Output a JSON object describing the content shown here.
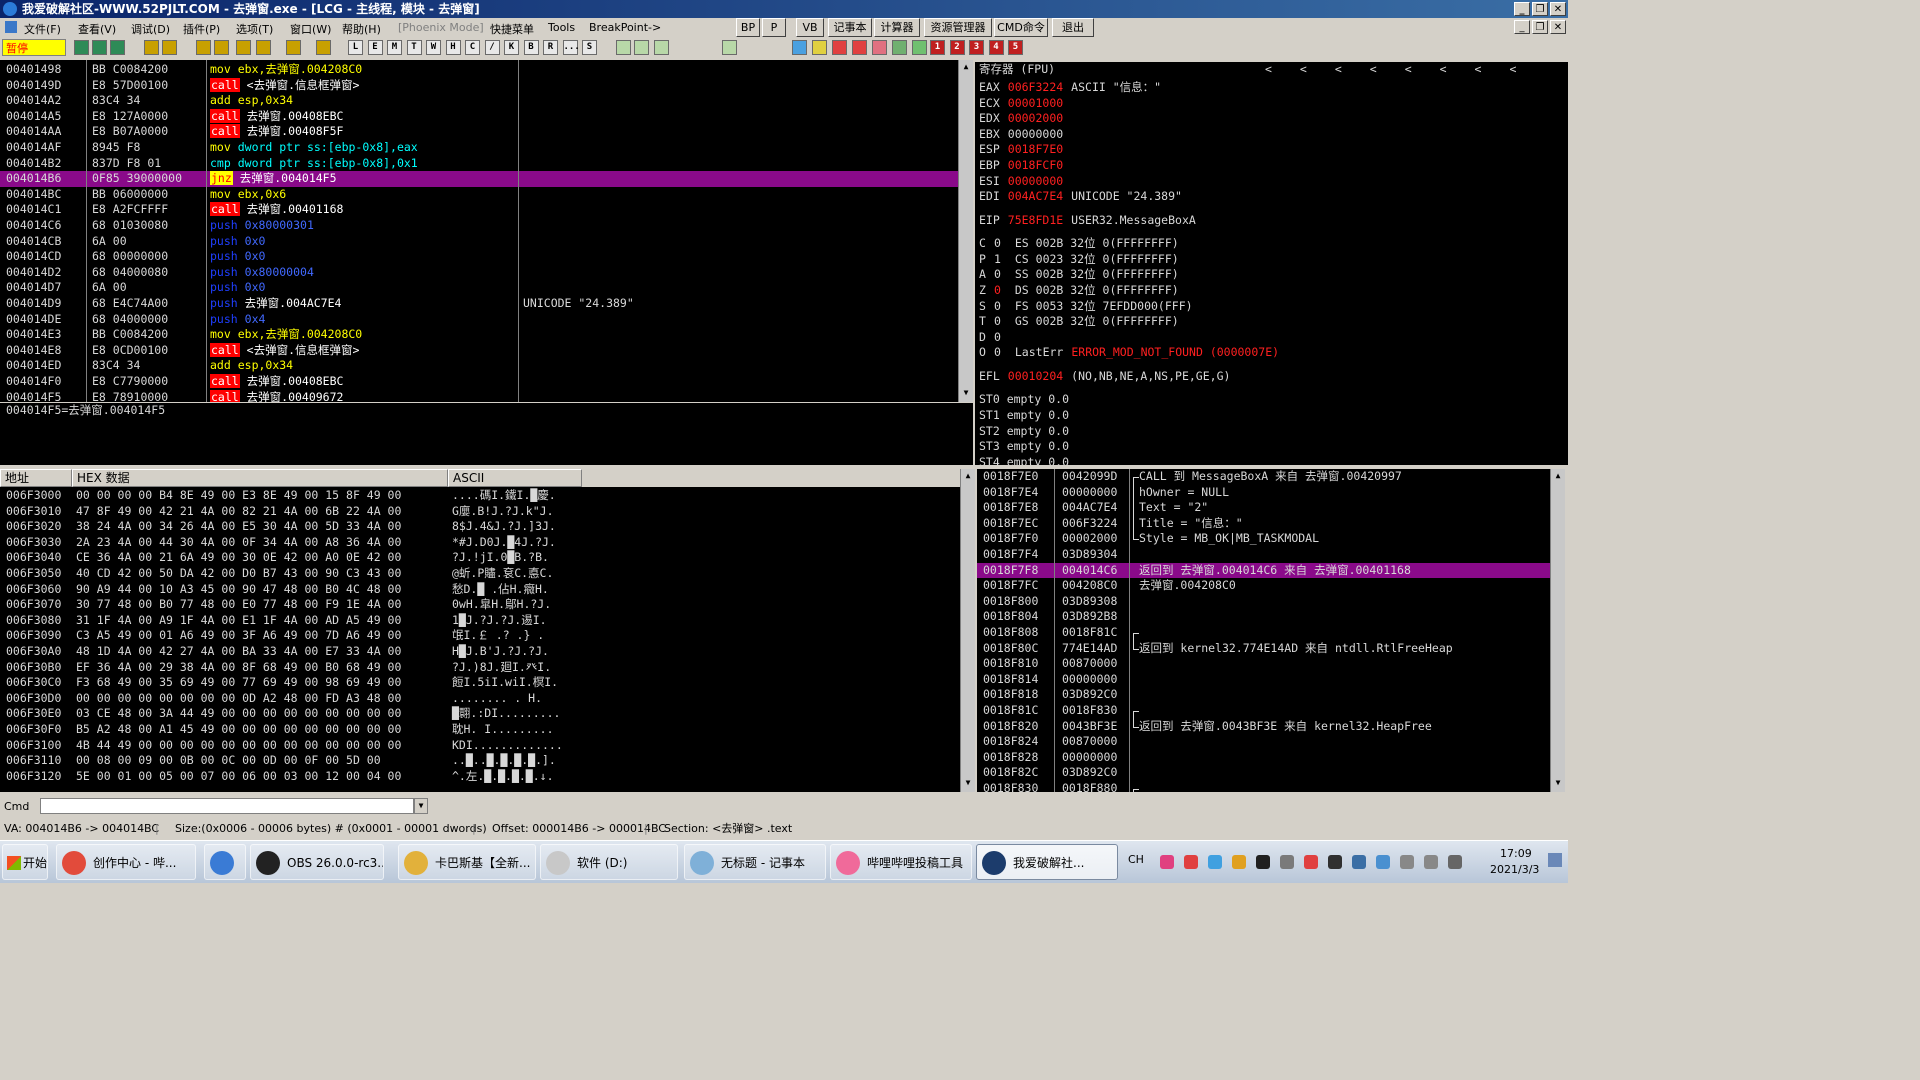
{
  "title": "我爱破解社区-WWW.52PJLT.COM - 去弹窗.exe - [LCG - 主线程, 模块 - 去弹窗]",
  "menu": {
    "items": [
      "文件(F)",
      "查看(V)",
      "调试(D)",
      "插件(P)",
      "选项(T)",
      "窗口(W)",
      "帮助(H)",
      "[Phoenix Mode]",
      "快捷菜单",
      "Tools",
      "BreakPoint->"
    ],
    "buttons": [
      "BP",
      "P",
      "VB",
      "记事本",
      "计算器",
      "资源管理器",
      "CMD命令",
      "退出"
    ]
  },
  "toolbar": {
    "status": "暂停",
    "letters": [
      "L",
      "E",
      "M",
      "T",
      "W",
      "H",
      "C",
      "/",
      "K",
      "B",
      "R",
      "...",
      "S"
    ],
    "numbers": [
      "1",
      "2",
      "3",
      "4",
      "5"
    ]
  },
  "disasm": {
    "rows": [
      {
        "addr": "00401498",
        "hex": "BB C0084200",
        "mn": "mov",
        "mncls": "kw-mov",
        "ops": "ebx,去弹窗.004208C0",
        "opcls": "opnd-y",
        "cmt": ""
      },
      {
        "addr": "0040149D",
        "hex": "E8 57D00100",
        "mn": "call",
        "mncls": "kw-call",
        "ops": "<去弹窗.信息框弹窗>",
        "opcls": "opnd-w",
        "cmt": ""
      },
      {
        "addr": "004014A2",
        "hex": "83C4 34",
        "mn": "add",
        "mncls": "kw-add",
        "ops": "esp,0x34",
        "opcls": "opnd-y",
        "cmt": ""
      },
      {
        "addr": "004014A5",
        "hex": "E8 127A0000",
        "mn": "call",
        "mncls": "kw-call",
        "ops": "去弹窗.00408EBC",
        "opcls": "opnd-w",
        "cmt": ""
      },
      {
        "addr": "004014AA",
        "hex": "E8 B07A0000",
        "mn": "call",
        "mncls": "kw-call",
        "ops": "去弹窗.00408F5F",
        "opcls": "opnd-w",
        "cmt": ""
      },
      {
        "addr": "004014AF",
        "hex": "8945 F8",
        "mn": "mov",
        "mncls": "kw-mov",
        "ops": "dword ptr ss:[ebp-0x8],eax",
        "opcls": "opnd-c",
        "cmt": ""
      },
      {
        "addr": "004014B2",
        "hex": "837D F8 01",
        "mn": "cmp",
        "mncls": "kw-cmp",
        "ops": "dword ptr ss:[ebp-0x8],0x1",
        "opcls": "opnd-c",
        "cmt": ""
      },
      {
        "addr": "004014B6",
        "hex": "0F85 39000000",
        "mn": "jnz",
        "mncls": "kw-jnz",
        "ops": "去弹窗.004014F5",
        "opcls": "opnd-w",
        "cmt": "",
        "sel": true
      },
      {
        "addr": "004014BC",
        "hex": "BB 06000000",
        "mn": "mov",
        "mncls": "kw-mov",
        "ops": "ebx,0x6",
        "opcls": "opnd-y",
        "cmt": ""
      },
      {
        "addr": "004014C1",
        "hex": "E8 A2FCFFFF",
        "mn": "call",
        "mncls": "kw-call",
        "ops": "去弹窗.00401168",
        "opcls": "opnd-w",
        "cmt": ""
      },
      {
        "addr": "004014C6",
        "hex": "68 01030080",
        "mn": "push",
        "mncls": "kw-push",
        "ops": "0x80000301",
        "opcls": "opnd-b",
        "cmt": ""
      },
      {
        "addr": "004014CB",
        "hex": "6A 00",
        "mn": "push",
        "mncls": "kw-push",
        "ops": "0x0",
        "opcls": "opnd-b",
        "cmt": ""
      },
      {
        "addr": "004014CD",
        "hex": "68 00000000",
        "mn": "push",
        "mncls": "kw-push",
        "ops": "0x0",
        "opcls": "opnd-b",
        "cmt": ""
      },
      {
        "addr": "004014D2",
        "hex": "68 04000080",
        "mn": "push",
        "mncls": "kw-push",
        "ops": "0x80000004",
        "opcls": "opnd-b",
        "cmt": ""
      },
      {
        "addr": "004014D7",
        "hex": "6A 00",
        "mn": "push",
        "mncls": "kw-push",
        "ops": "0x0",
        "opcls": "opnd-b",
        "cmt": ""
      },
      {
        "addr": "004014D9",
        "hex": "68 E4C74A00",
        "mn": "push",
        "mncls": "kw-push",
        "ops": "去弹窗.004AC7E4",
        "opcls": "opnd-w",
        "cmt": "UNICODE \"24.389\""
      },
      {
        "addr": "004014DE",
        "hex": "68 04000000",
        "mn": "push",
        "mncls": "kw-push",
        "ops": "0x4",
        "opcls": "opnd-b",
        "cmt": ""
      },
      {
        "addr": "004014E3",
        "hex": "BB C0084200",
        "mn": "mov",
        "mncls": "kw-mov",
        "ops": "ebx,去弹窗.004208C0",
        "opcls": "opnd-y",
        "cmt": ""
      },
      {
        "addr": "004014E8",
        "hex": "E8 0CD00100",
        "mn": "call",
        "mncls": "kw-call",
        "ops": "<去弹窗.信息框弹窗>",
        "opcls": "opnd-w",
        "cmt": ""
      },
      {
        "addr": "004014ED",
        "hex": "83C4 34",
        "mn": "add",
        "mncls": "kw-add",
        "ops": "esp,0x34",
        "opcls": "opnd-y",
        "cmt": ""
      },
      {
        "addr": "004014F0",
        "hex": "E8 C7790000",
        "mn": "call",
        "mncls": "kw-call",
        "ops": "去弹窗.00408EBC",
        "opcls": "opnd-w",
        "cmt": ""
      },
      {
        "addr": "004014F5",
        "hex": "E8 78910000",
        "mn": "call",
        "mncls": "kw-call",
        "ops": "去弹窗.00409672",
        "opcls": "opnd-w",
        "cmt": ""
      }
    ],
    "info": "004014F5=去弹窗.004014F5"
  },
  "registers": {
    "header": "寄存器 (FPU)",
    "rows": [
      {
        "name": "EAX",
        "val": "006F3224",
        "valcls": "red",
        "desc": "ASCII \"信息：\""
      },
      {
        "name": "ECX",
        "val": "00001000",
        "valcls": "red",
        "desc": ""
      },
      {
        "name": "EDX",
        "val": "00002000",
        "valcls": "red",
        "desc": ""
      },
      {
        "name": "EBX",
        "val": "00000000",
        "valcls": "",
        "desc": ""
      },
      {
        "name": "ESP",
        "val": "0018F7E0",
        "valcls": "red",
        "desc": ""
      },
      {
        "name": "EBP",
        "val": "0018FCF0",
        "valcls": "red",
        "desc": ""
      },
      {
        "name": "ESI",
        "val": "00000000",
        "valcls": "red",
        "desc": ""
      },
      {
        "name": "EDI",
        "val": "004AC7E4",
        "valcls": "red",
        "desc": "UNICODE \"24.389\""
      }
    ],
    "eip": {
      "name": "EIP",
      "val": "75E8FD1E",
      "desc": "USER32.MessageBoxA"
    },
    "flags": [
      {
        "f": "C",
        "v": "0",
        "seg": "ES 002B 32位 0(FFFFFFFF)"
      },
      {
        "f": "P",
        "v": "1",
        "seg": "CS 0023 32位 0(FFFFFFFF)"
      },
      {
        "f": "A",
        "v": "0",
        "seg": "SS 002B 32位 0(FFFFFFFF)"
      },
      {
        "f": "Z",
        "v": "0",
        "seg": "DS 002B 32位 0(FFFFFFFF)",
        "vred": true
      },
      {
        "f": "S",
        "v": "0",
        "seg": "FS 0053 32位 7EFDD000(FFF)"
      },
      {
        "f": "T",
        "v": "0",
        "seg": "GS 002B 32位 0(FFFFFFFF)"
      },
      {
        "f": "D",
        "v": "0",
        "seg": ""
      },
      {
        "f": "O",
        "v": "0",
        "seg": "LastErr",
        "err": "ERROR_MOD_NOT_FOUND (0000007E)"
      }
    ],
    "efl": {
      "name": "EFL",
      "val": "00010204",
      "desc": "(NO,NB,NE,A,NS,PE,GE,G)"
    },
    "fpu": [
      "ST0 empty 0.0",
      "ST1 empty 0.0",
      "ST2 empty 0.0",
      "ST3 empty 0.0",
      "ST4 empty 0.0"
    ]
  },
  "dump": {
    "headers": {
      "addr": "地址",
      "hex": "HEX 数据",
      "ascii": "ASCII"
    },
    "rows": [
      {
        "a": "006F3000",
        "h": "00 00 00 00 B4 8E 49 00 E3 8E 49 00 15 8F 49 00",
        "s": "....碼I.鐵I.█慶."
      },
      {
        "a": "006F3010",
        "h": "47 8F 49 00 42 21 4A 00 82 21 4A 00 6B 22 4A 00",
        "s": "G廮.B!J.?J.k\"J."
      },
      {
        "a": "006F3020",
        "h": "38 24 4A 00 34 26 4A 00 E5 30 4A 00 5D 33 4A 00",
        "s": "8$J.4&J.?J.]3J."
      },
      {
        "a": "006F3030",
        "h": "2A 23 4A 00 44 30 4A 00 0F 34 4A 00 A8 36 4A 00",
        "s": "*#J.D0J.█4J.?J."
      },
      {
        "a": "006F3040",
        "h": "CE 36 4A 00 21 6A 49 00 30 0E 42 00 A0 0E 42 00",
        "s": "?J.!jI.0█B.?B."
      },
      {
        "a": "006F3050",
        "h": "40 CD 42 00 50 DA 42 00 D0 B7 43 00 90 C3 43 00",
        "s": "@蚚.P贐.袞C.悳C."
      },
      {
        "a": "006F3060",
        "h": "90 A9 44 00 10 A3 45 00 90 47 48 00 B0 4C 48 00",
        "s": "愁D.█ .佔H.癓H."
      },
      {
        "a": "006F3070",
        "h": "30 77 48 00 B0 77 48 00 E0 77 48 00 F9 1E 4A 00",
        "s": "0wH.皐H.鄔H.?J."
      },
      {
        "a": "006F3080",
        "h": "31 1F 4A 00 A9 1F 4A 00 E1 1F 4A 00 AD A5 49 00",
        "s": "1█J.?J.?J.逷I."
      },
      {
        "a": "006F3090",
        "h": "C3 A5 49 00 01 A6 49 00 3F A6 49 00 7D A6 49 00",
        "s": "氓I.￡ .?  .}  ."
      },
      {
        "a": "006F30A0",
        "h": "48 1D 4A 00 42 27 4A 00 BA 33 4A 00 E7 33 4A 00",
        "s": "H█J.B'J.?J.?J."
      },
      {
        "a": "006F30B0",
        "h": "EF 36 4A 00 29 38 4A 00 8F 68 49 00 B0 68 49 00",
        "s": "?J.)8J.廻I.癶I."
      },
      {
        "a": "006F30C0",
        "h": "F3 68 49 00 35 69 49 00 77 69 49 00 98 69 49 00",
        "s": "餖I.5iI.wiI.榠I."
      },
      {
        "a": "006F30D0",
        "h": "00 00 00 00 00 00 00 00 0D A2 48 00 FD A3 48 00",
        "s": "........  .  H."
      },
      {
        "a": "006F30E0",
        "h": "03 CE 48 00 3A 44 49 00 00 00 00 00 00 00 00 00",
        "s": "█翾.:DI........."
      },
      {
        "a": "006F30F0",
        "h": "B5 A2 48 00 A1 45 49 00 00 00 00 00 00 00 00 00",
        "s": "耽H.  I........."
      },
      {
        "a": "006F3100",
        "h": "4B 44 49 00 00 00 00 00 00 00 00 00 00 00 00 00",
        "s": "KDI............."
      },
      {
        "a": "006F3110",
        "h": "00 08 00 09 00 0B 00 0C 00 0D 00 0F 00 5D 00",
        "s": "..█..█.█.█.█.]."
      },
      {
        "a": "006F3120",
        "h": "5E 00 01 00 05 00 07 00 06 00 03 00 12 00 04 00",
        "s": "^.左.█.█.█.█.↓."
      }
    ]
  },
  "stack": {
    "rows": [
      {
        "a": "0018F7E0",
        "v": "0042099D",
        "c": "CALL 到 MessageBoxA 来自 去弹窗.00420997",
        "br": "top"
      },
      {
        "a": "0018F7E4",
        "v": "00000000",
        "c": "hOwner = NULL",
        "br": "mid"
      },
      {
        "a": "0018F7E8",
        "v": "004AC7E4",
        "c": "Text = \"2\"",
        "br": "mid"
      },
      {
        "a": "0018F7EC",
        "v": "006F3224",
        "c": "Title = \"信息：\"",
        "br": "mid"
      },
      {
        "a": "0018F7F0",
        "v": "00002000",
        "c": "Style = MB_OK|MB_TASKMODAL",
        "br": "bot"
      },
      {
        "a": "0018F7F4",
        "v": "03D89304",
        "c": "",
        "br": ""
      },
      {
        "a": "0018F7F8",
        "v": "004014C6",
        "c": "返回到 去弹窗.004014C6 来自 去弹窗.00401168",
        "br": "",
        "sel": true
      },
      {
        "a": "0018F7FC",
        "v": "004208C0",
        "c": "去弹窗.004208C0",
        "br": ""
      },
      {
        "a": "0018F800",
        "v": "03D89308",
        "c": "",
        "br": ""
      },
      {
        "a": "0018F804",
        "v": "03D892B8",
        "c": "",
        "br": ""
      },
      {
        "a": "0018F808",
        "v": "0018F81C",
        "c": "",
        "br": "top"
      },
      {
        "a": "0018F80C",
        "v": "774E14AD",
        "c": "返回到 kernel32.774E14AD 来自 ntdll.RtlFreeHeap",
        "br": "bot"
      },
      {
        "a": "0018F810",
        "v": "00870000",
        "c": "",
        "br": ""
      },
      {
        "a": "0018F814",
        "v": "00000000",
        "c": "",
        "br": ""
      },
      {
        "a": "0018F818",
        "v": "03D892C0",
        "c": "",
        "br": ""
      },
      {
        "a": "0018F81C",
        "v": "0018F830",
        "c": "",
        "br": "top"
      },
      {
        "a": "0018F820",
        "v": "0043BF3E",
        "c": "返回到 去弹窗.0043BF3E 来自 kernel32.HeapFree",
        "br": "bot"
      },
      {
        "a": "0018F824",
        "v": "00870000",
        "c": "",
        "br": ""
      },
      {
        "a": "0018F828",
        "v": "00000000",
        "c": "",
        "br": ""
      },
      {
        "a": "0018F82C",
        "v": "03D892C0",
        "c": "",
        "br": ""
      },
      {
        "a": "0018F830",
        "v": "0018F880",
        "c": "",
        "br": "top"
      }
    ]
  },
  "cmd": {
    "label": "Cmd",
    "value": ""
  },
  "status": {
    "va": "VA: 004014B6 -> 004014BC",
    "size": "Size:(0x0006 - 00006 bytes)  #  (0x0001 - 00001 dwords)",
    "offset": "Offset: 000014B6 -> 000014BC",
    "section": "Section: <去弹窗> .text"
  },
  "taskbar": {
    "start": "开始",
    "tasks": [
      {
        "label": "创作中心 - 哔...",
        "color": "#e24b3b"
      },
      {
        "label": "",
        "color": "#3a7bd5"
      },
      {
        "label": "OBS 26.0.0-rc3...",
        "color": "#222"
      },
      {
        "label": "卡巴斯基【全新...",
        "color": "#e2b13b"
      },
      {
        "label": "软件 (D:)",
        "color": "#c8c8c8"
      },
      {
        "label": "无标题 - 记事本",
        "color": "#7fb0d8"
      },
      {
        "label": "哔哩哔哩投稿工具",
        "color": "#f06a9a"
      },
      {
        "label": "我爱破解社...",
        "color": "#1c3c6c"
      }
    ],
    "ime": "CH",
    "time": "17:09",
    "date": "2021/3/3"
  },
  "colors": {
    "highlight": "#8a0a8a",
    "call": "#ff0000",
    "jnz": "#ffff00",
    "background": "#000000"
  }
}
